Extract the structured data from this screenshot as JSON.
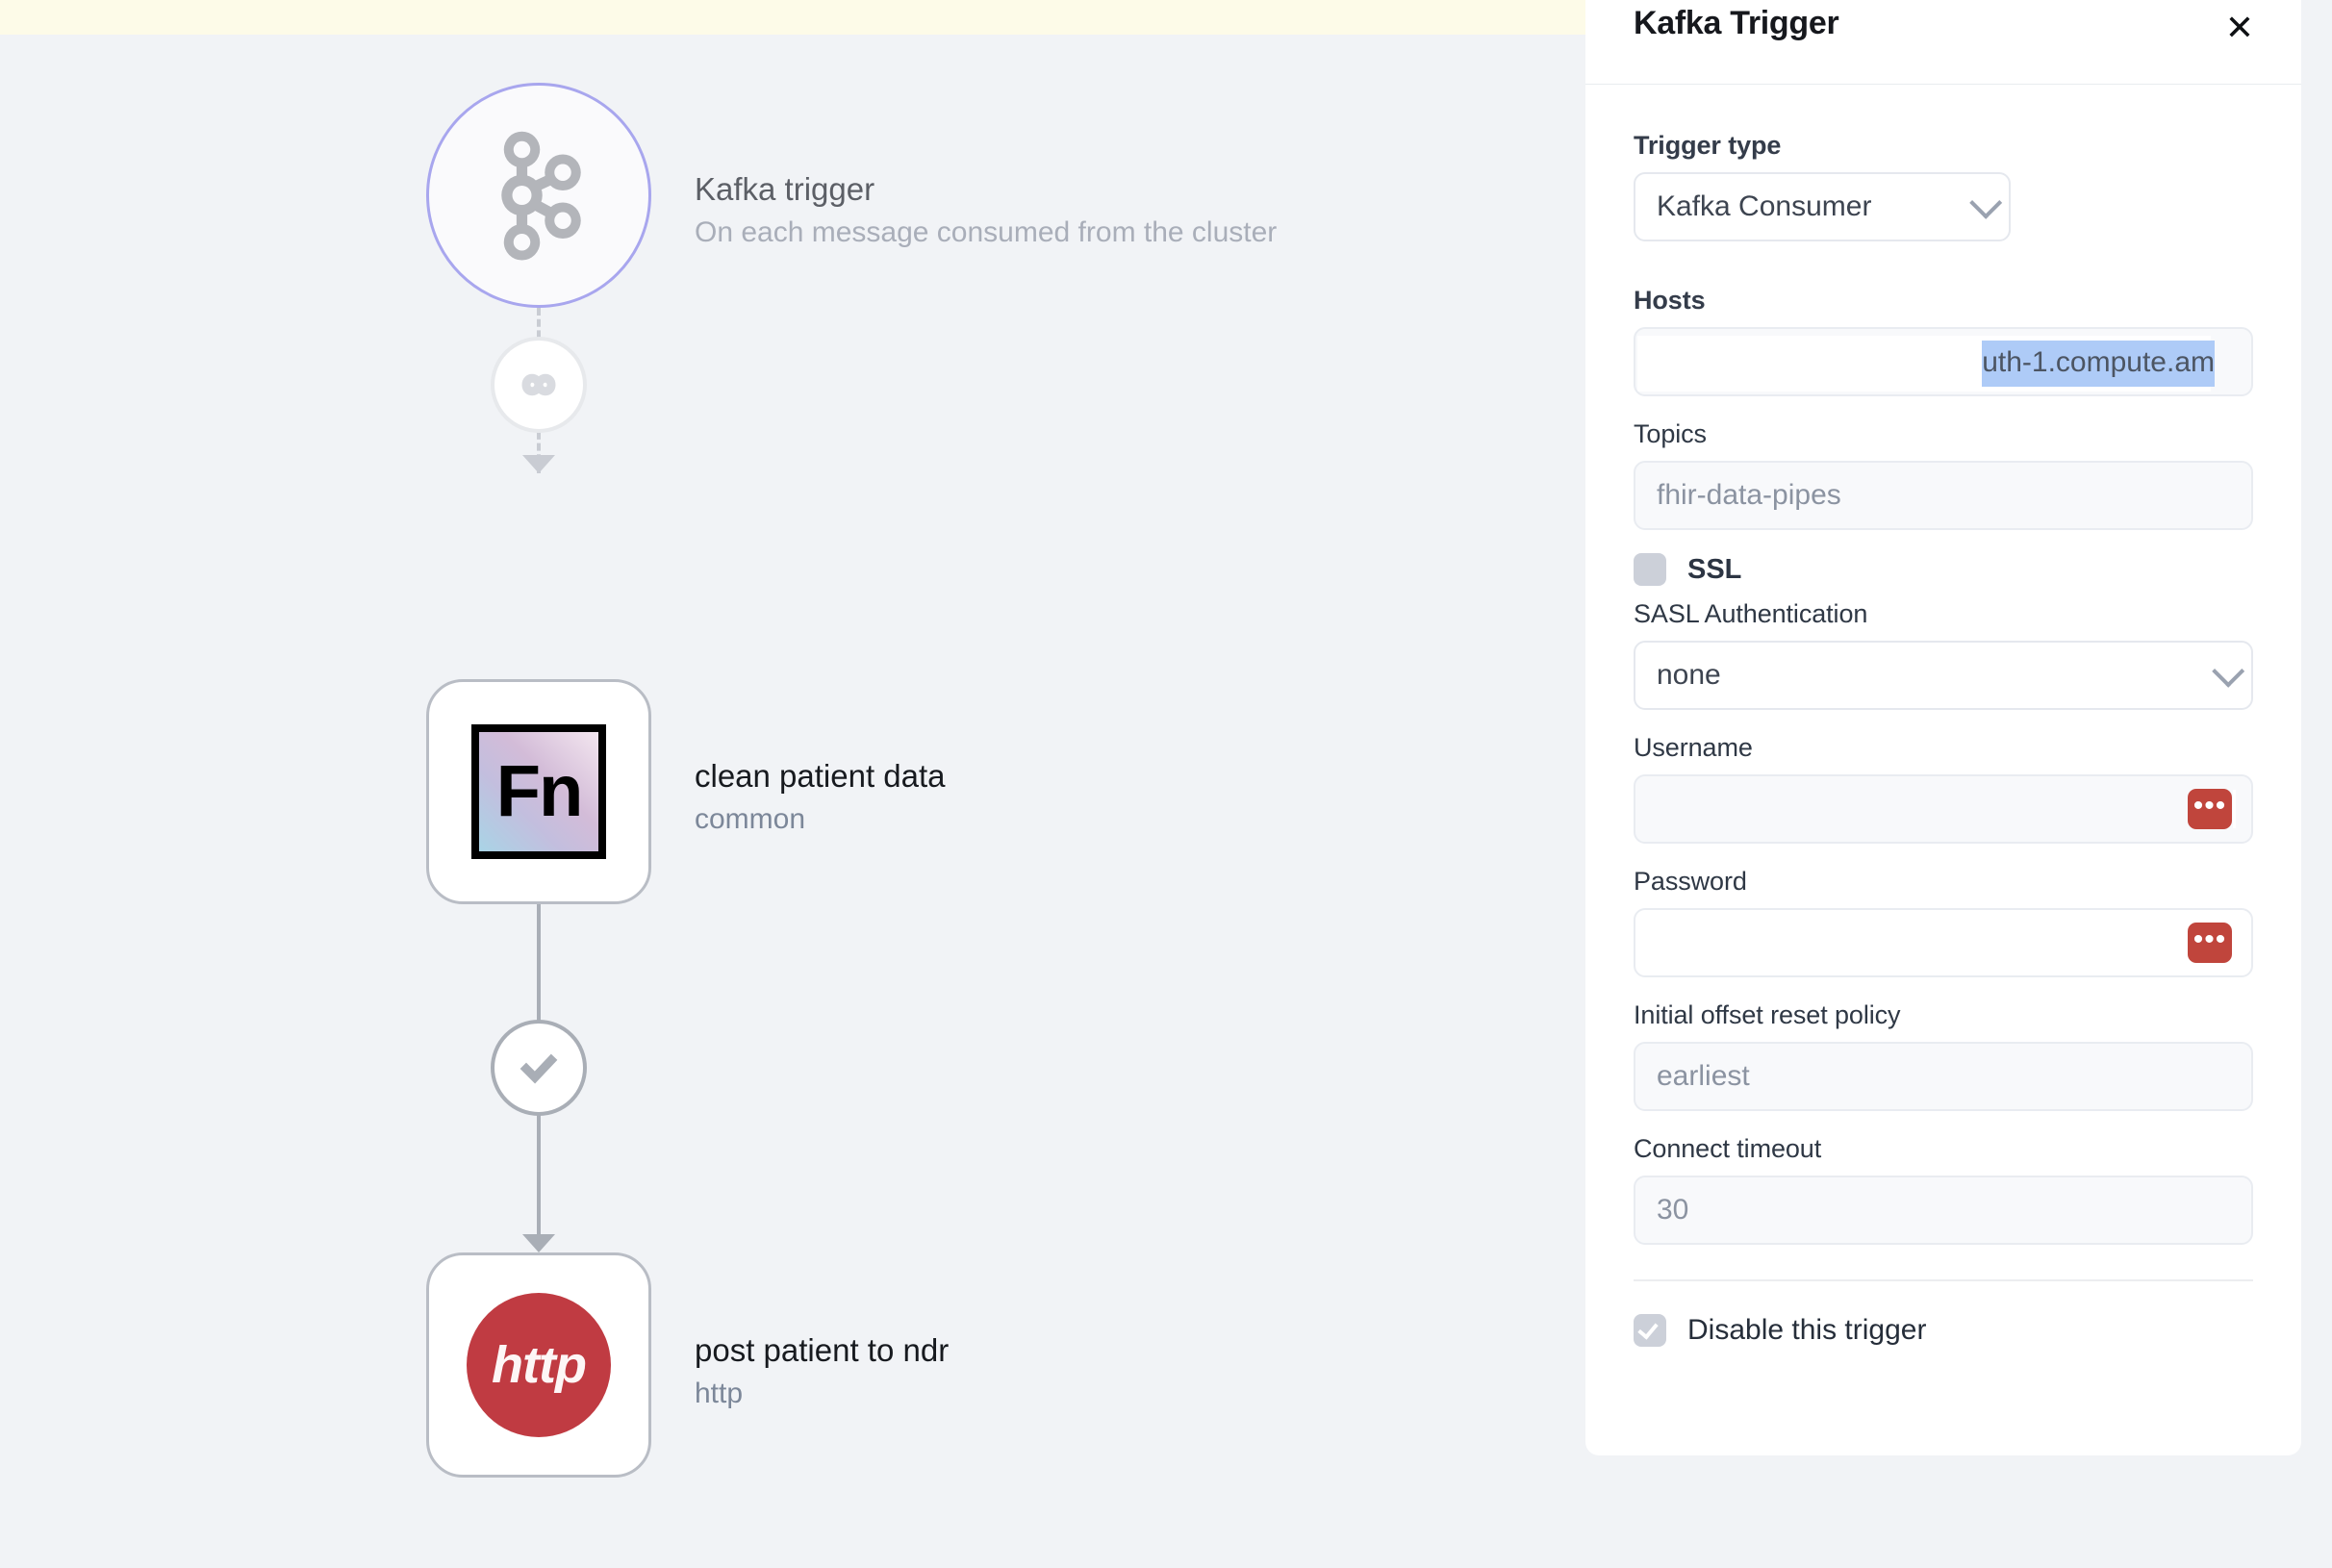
{
  "canvas": {
    "nodes": [
      {
        "id": "kafka-trigger",
        "title": "Kafka trigger",
        "subtitle": "On each message consumed from the cluster",
        "icon": "kafka-icon"
      },
      {
        "id": "clean-patient-data",
        "title": "clean patient data",
        "subtitle": "common",
        "icon": "fn-icon",
        "icon_text": "Fn"
      },
      {
        "id": "post-patient-to-ndr",
        "title": "post patient to ndr",
        "subtitle": "http",
        "icon": "http-icon",
        "icon_text": "http"
      }
    ],
    "connectors": [
      {
        "id": "connector-1",
        "icon": "infinity-icon",
        "style": "dashed"
      },
      {
        "id": "connector-2",
        "icon": "check-icon",
        "style": "solid"
      }
    ]
  },
  "panel": {
    "title": "Kafka Trigger",
    "close_label": "✕",
    "fields": {
      "trigger_type": {
        "label": "Trigger type",
        "value": "Kafka Consumer"
      },
      "hosts": {
        "label": "Hosts",
        "selected_text": "uth-1.compute.am",
        "value": ""
      },
      "topics": {
        "label": "Topics",
        "placeholder": "fhir-data-pipes"
      },
      "ssl": {
        "label": "SSL",
        "checked": false
      },
      "sasl_authentication": {
        "label": "SASL Authentication",
        "value": "none"
      },
      "username": {
        "label": "Username",
        "value": "",
        "badge": "•••"
      },
      "password": {
        "label": "Password",
        "value": "",
        "badge": "•••"
      },
      "initial_offset_reset_policy": {
        "label": "Initial offset reset policy",
        "placeholder": "earliest"
      },
      "connect_timeout": {
        "label": "Connect timeout",
        "placeholder": "30"
      },
      "disable_trigger": {
        "label": "Disable this trigger",
        "checked": true
      }
    }
  },
  "colors": {
    "trigger_ring": "#a8a6ee",
    "http_red": "#c03b42",
    "secret_red": "#c0453c",
    "selection_blue": "#aecbf7",
    "banner_yellow": "#fdfbe8",
    "canvas_bg": "#f1f3f6"
  }
}
